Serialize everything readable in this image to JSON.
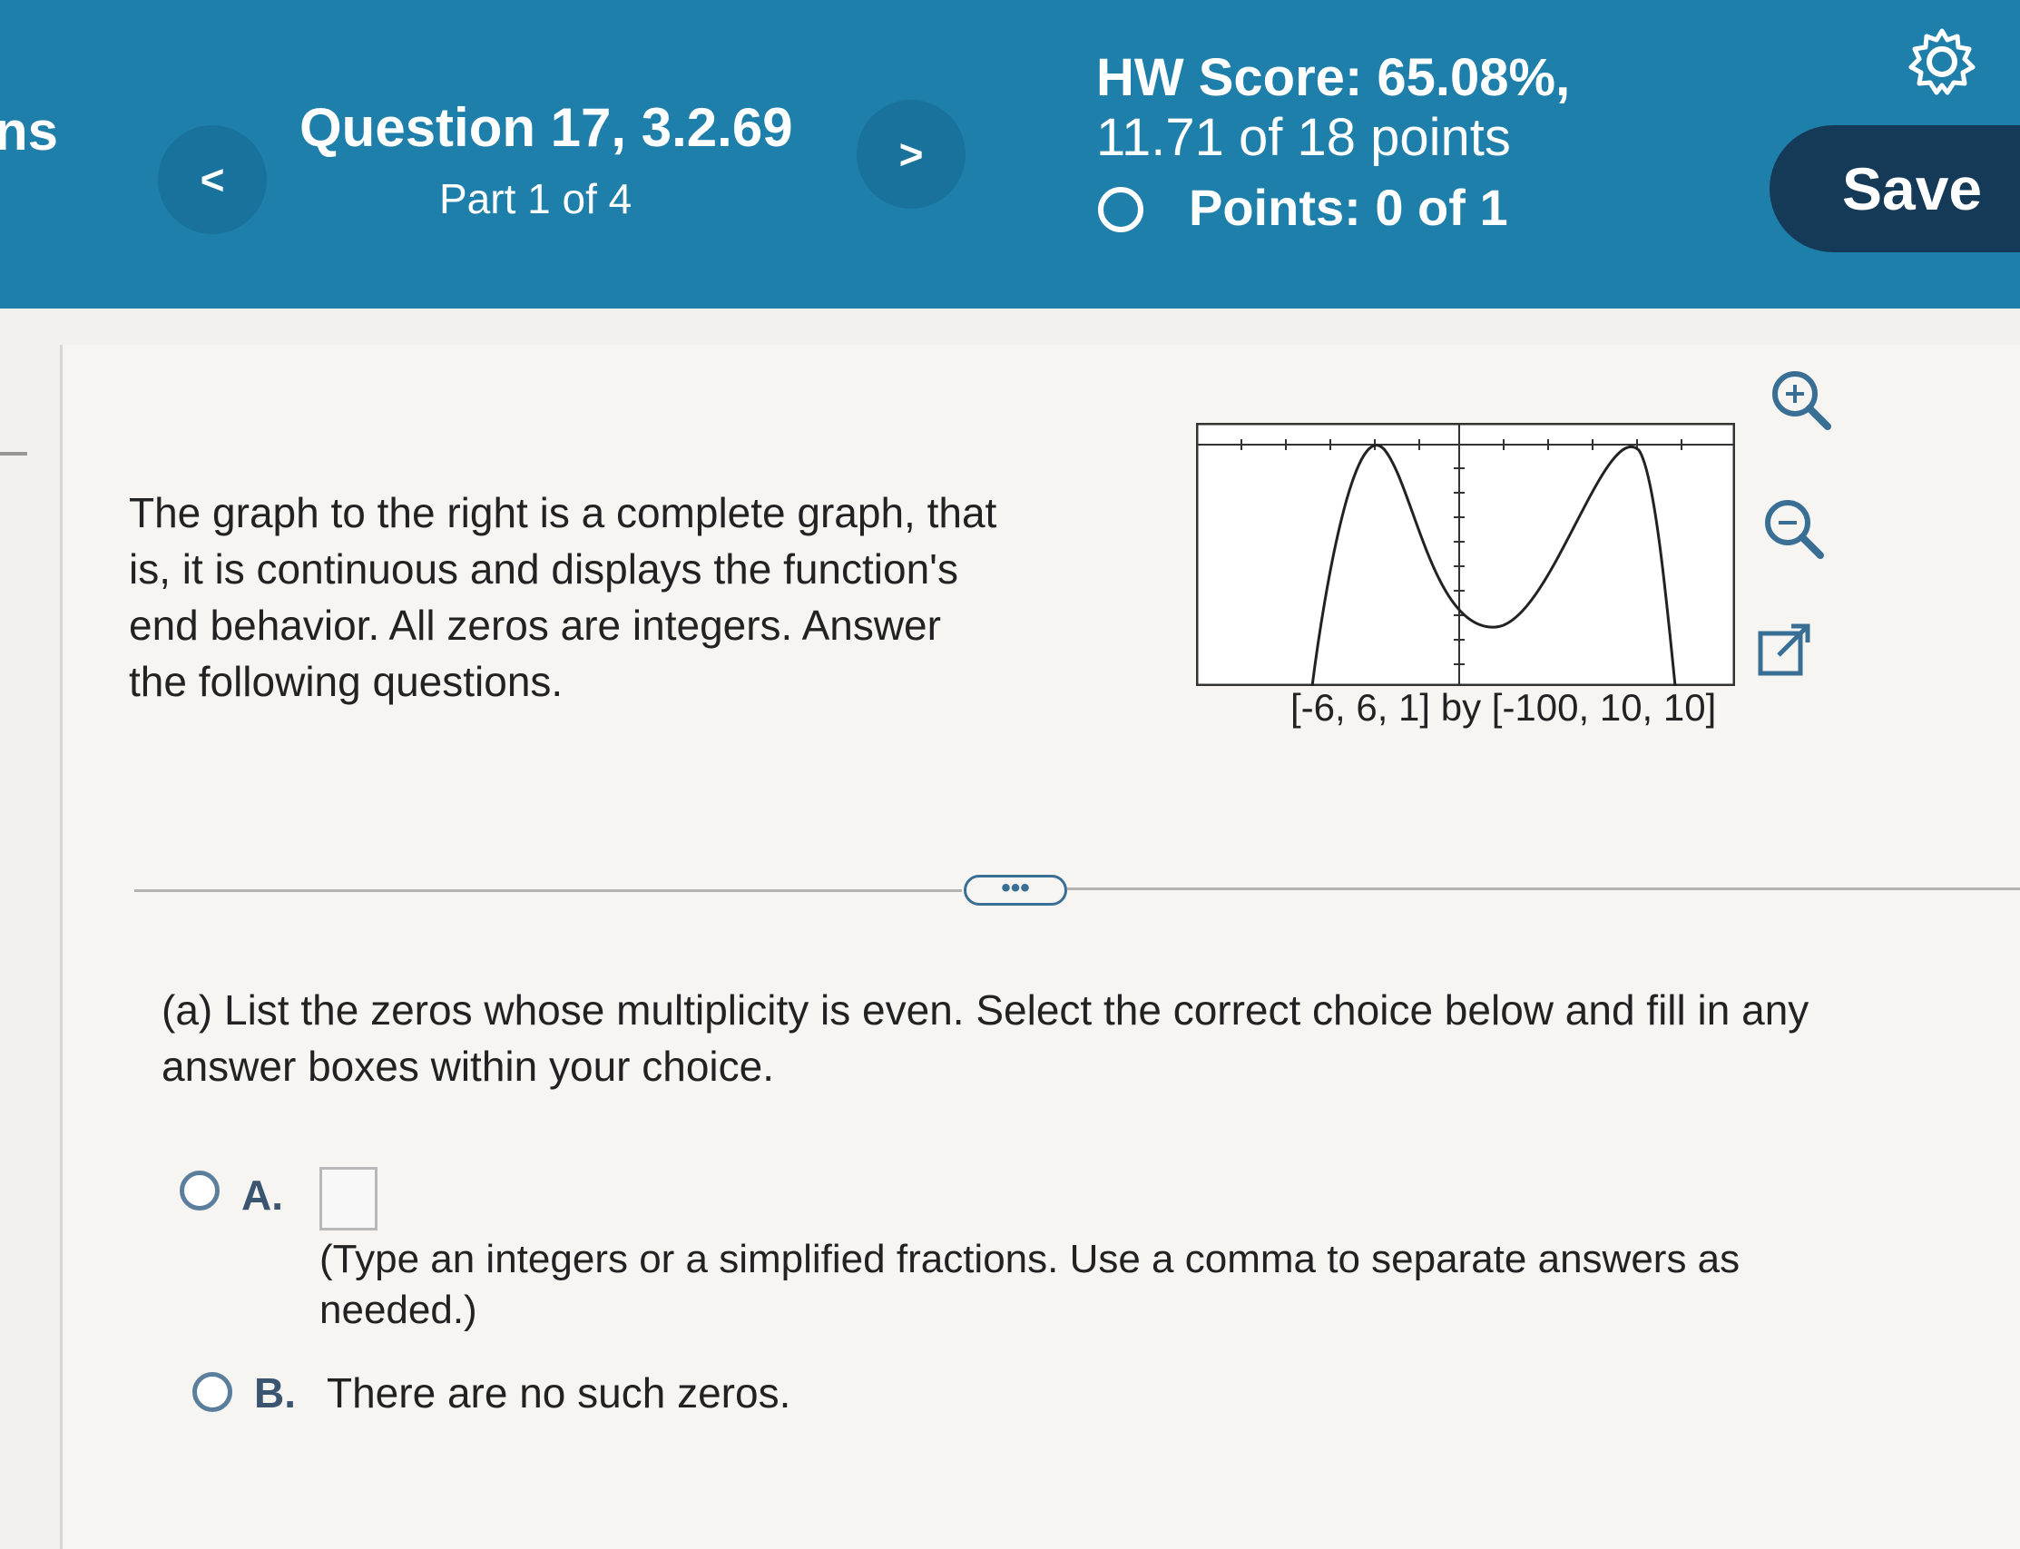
{
  "header": {
    "left_stub": "ns",
    "prev_label": "<",
    "next_label": ">",
    "question_title": "Question 17, 3.2.69",
    "part": "Part 1 of 4",
    "hw_score": "HW Score: 65.08%,",
    "hw_points": "11.71 of 18 points",
    "points": "Points: 0 of 1",
    "save_label": "Save"
  },
  "problem": {
    "intro": "The graph to the right is a complete graph, that is, it is continuous and displays the function's end behavior. All zeros are integers. Answer the following questions.",
    "graph_caption": "[-6, 6, 1] by [-100, 10, 10]",
    "tools": [
      "zoom-in-icon",
      "zoom-out-icon",
      "open-external-icon"
    ]
  },
  "more_label": "•••",
  "question_a": {
    "prompt": "(a) List the zeros whose multiplicity is even. Select the correct choice below and fill in any answer boxes within your choice.",
    "option_a_label": "A.",
    "option_a_hint": "(Type an integers or a simplified fractions. Use a comma to separate answers as needed.)",
    "option_b_label": "B.",
    "option_b_text": "There are no such zeros."
  },
  "colors": {
    "header_bg": "#1f7fab",
    "save_bg": "#143a58",
    "radio_border": "#5a7e9c"
  }
}
